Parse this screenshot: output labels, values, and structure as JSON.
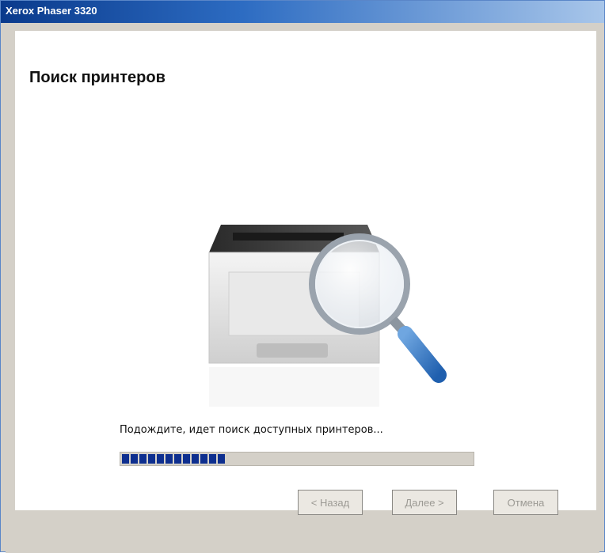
{
  "window": {
    "title": "Xerox Phaser 3320"
  },
  "page": {
    "heading": "Поиск принтеров",
    "status_text": "Подождите, идет поиск доступных принтеров...",
    "progress_percent": 29
  },
  "illustration": {
    "icon": "printer-with-magnifier-icon"
  },
  "buttons": {
    "back": "< Назад",
    "next": "Далее >",
    "cancel": "Отмена"
  }
}
